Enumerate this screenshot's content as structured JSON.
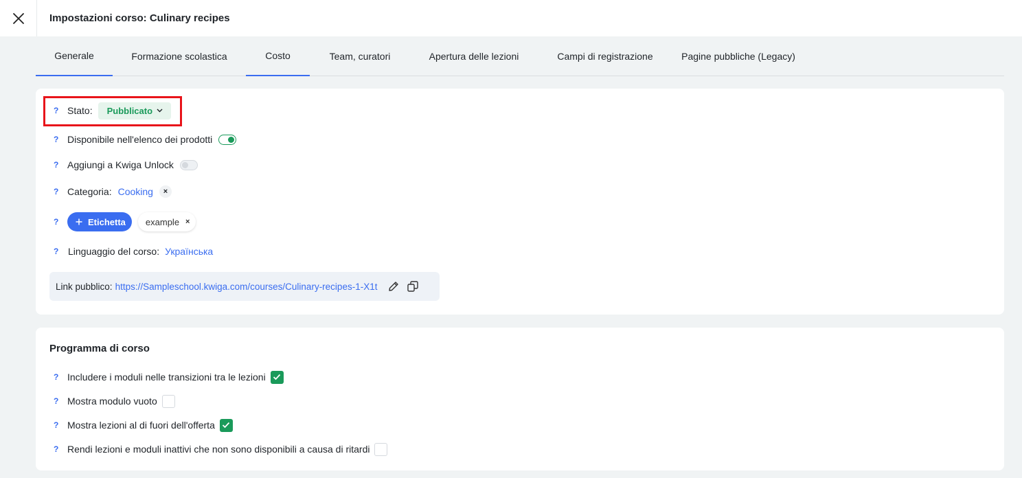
{
  "header": {
    "title": "Impostazioni corso: Culinary recipes"
  },
  "tabs": [
    {
      "label": "Generale"
    },
    {
      "label": "Formazione scolastica"
    },
    {
      "label": "Costo"
    },
    {
      "label": "Team, curatori"
    },
    {
      "label": "Apertura delle lezioni"
    },
    {
      "label": "Campi di registrazione"
    },
    {
      "label": "Pagine pubbliche (Legacy)"
    }
  ],
  "general": {
    "help": "?",
    "status_label": "Stato:",
    "status_value": "Pubblicato",
    "available_label": "Disponibile nell'elenco dei prodotti",
    "available_on": true,
    "unlock_label": "Aggiungi a Kwiga Unlock",
    "unlock_on": false,
    "category_label": "Categoria:",
    "category_value": "Cooking",
    "remove_symbol": "×",
    "add_tag_label": "Etichetta",
    "tag_value": "example",
    "language_label": "Linguaggio del corso:",
    "language_value": "Українська",
    "public_link_label": "Link pubblico:",
    "public_link_url": "https://Sampleschool.kwiga.com/courses/Culinary-recipes-1-X1t"
  },
  "program": {
    "title": "Programma di corso",
    "help": "?",
    "items": [
      {
        "label": "Includere i moduli nelle transizioni tra le lezioni",
        "checked": true
      },
      {
        "label": "Mostra modulo vuoto",
        "checked": false
      },
      {
        "label": "Mostra lezioni al di fuori dell'offerta",
        "checked": true
      },
      {
        "label": "Rendi lezioni e moduli inattivi che non sono disponibili a causa di ritardi",
        "checked": false
      }
    ]
  },
  "colors": {
    "accent": "#3a6df0",
    "success": "#1a9a5a",
    "highlight": "#e8141a"
  }
}
